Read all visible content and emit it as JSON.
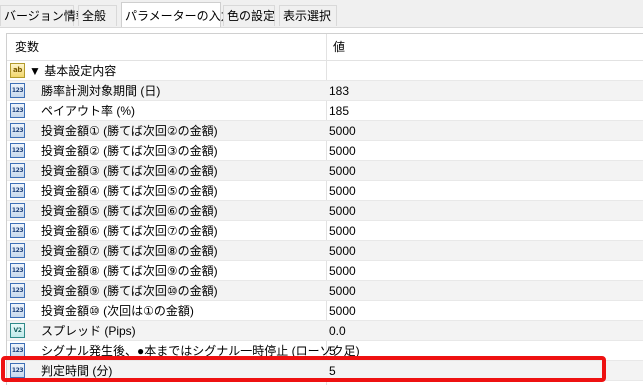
{
  "tabs": [
    {
      "label": "バージョン情報",
      "active": false
    },
    {
      "label": "全般",
      "active": false
    },
    {
      "label": "パラメーターの入力",
      "active": true
    },
    {
      "label": "色の設定",
      "active": false
    },
    {
      "label": "表示選択",
      "active": false
    }
  ],
  "table": {
    "header": {
      "variable": "変数",
      "value": "値"
    },
    "rows": [
      {
        "icon": "ab",
        "icon_name": "string-type-icon",
        "name": "▼ 基本設定内容",
        "value": "",
        "group": true
      },
      {
        "icon": "123",
        "icon_name": "integer-type-icon",
        "name": "勝率計測対象期間 (日)",
        "value": "183"
      },
      {
        "icon": "123",
        "icon_name": "integer-type-icon",
        "name": "ペイアウト率 (%)",
        "value": "185"
      },
      {
        "icon": "123",
        "icon_name": "integer-type-icon",
        "name": "投資金額① (勝てば次回②の金額)",
        "value": "5000"
      },
      {
        "icon": "123",
        "icon_name": "integer-type-icon",
        "name": "投資金額② (勝てば次回③の金額)",
        "value": "5000"
      },
      {
        "icon": "123",
        "icon_name": "integer-type-icon",
        "name": "投資金額③ (勝てば次回④の金額)",
        "value": "5000"
      },
      {
        "icon": "123",
        "icon_name": "integer-type-icon",
        "name": "投資金額④ (勝てば次回⑤の金額)",
        "value": "5000"
      },
      {
        "icon": "123",
        "icon_name": "integer-type-icon",
        "name": "投資金額⑤ (勝てば次回⑥の金額)",
        "value": "5000"
      },
      {
        "icon": "123",
        "icon_name": "integer-type-icon",
        "name": "投資金額⑥ (勝てば次回⑦の金額)",
        "value": "5000"
      },
      {
        "icon": "123",
        "icon_name": "integer-type-icon",
        "name": "投資金額⑦ (勝てば次回⑧の金額)",
        "value": "5000"
      },
      {
        "icon": "123",
        "icon_name": "integer-type-icon",
        "name": "投資金額⑧ (勝てば次回⑨の金額)",
        "value": "5000"
      },
      {
        "icon": "123",
        "icon_name": "integer-type-icon",
        "name": "投資金額⑨ (勝てば次回⑩の金額)",
        "value": "5000"
      },
      {
        "icon": "123",
        "icon_name": "integer-type-icon",
        "name": "投資金額⑩ (次回は①の金額)",
        "value": "5000"
      },
      {
        "icon": "V2",
        "icon_name": "double-type-icon",
        "name": "スプレッド (Pips)",
        "value": "0.0"
      },
      {
        "icon": "123",
        "icon_name": "integer-type-icon",
        "name": "シグナル発生後、●本まではシグナル一時停止 (ローソク足)",
        "value": "5"
      },
      {
        "icon": "123",
        "icon_name": "integer-type-icon",
        "name": "判定時間 (分)",
        "value": "5"
      }
    ]
  },
  "highlight_color": "#ee1111"
}
